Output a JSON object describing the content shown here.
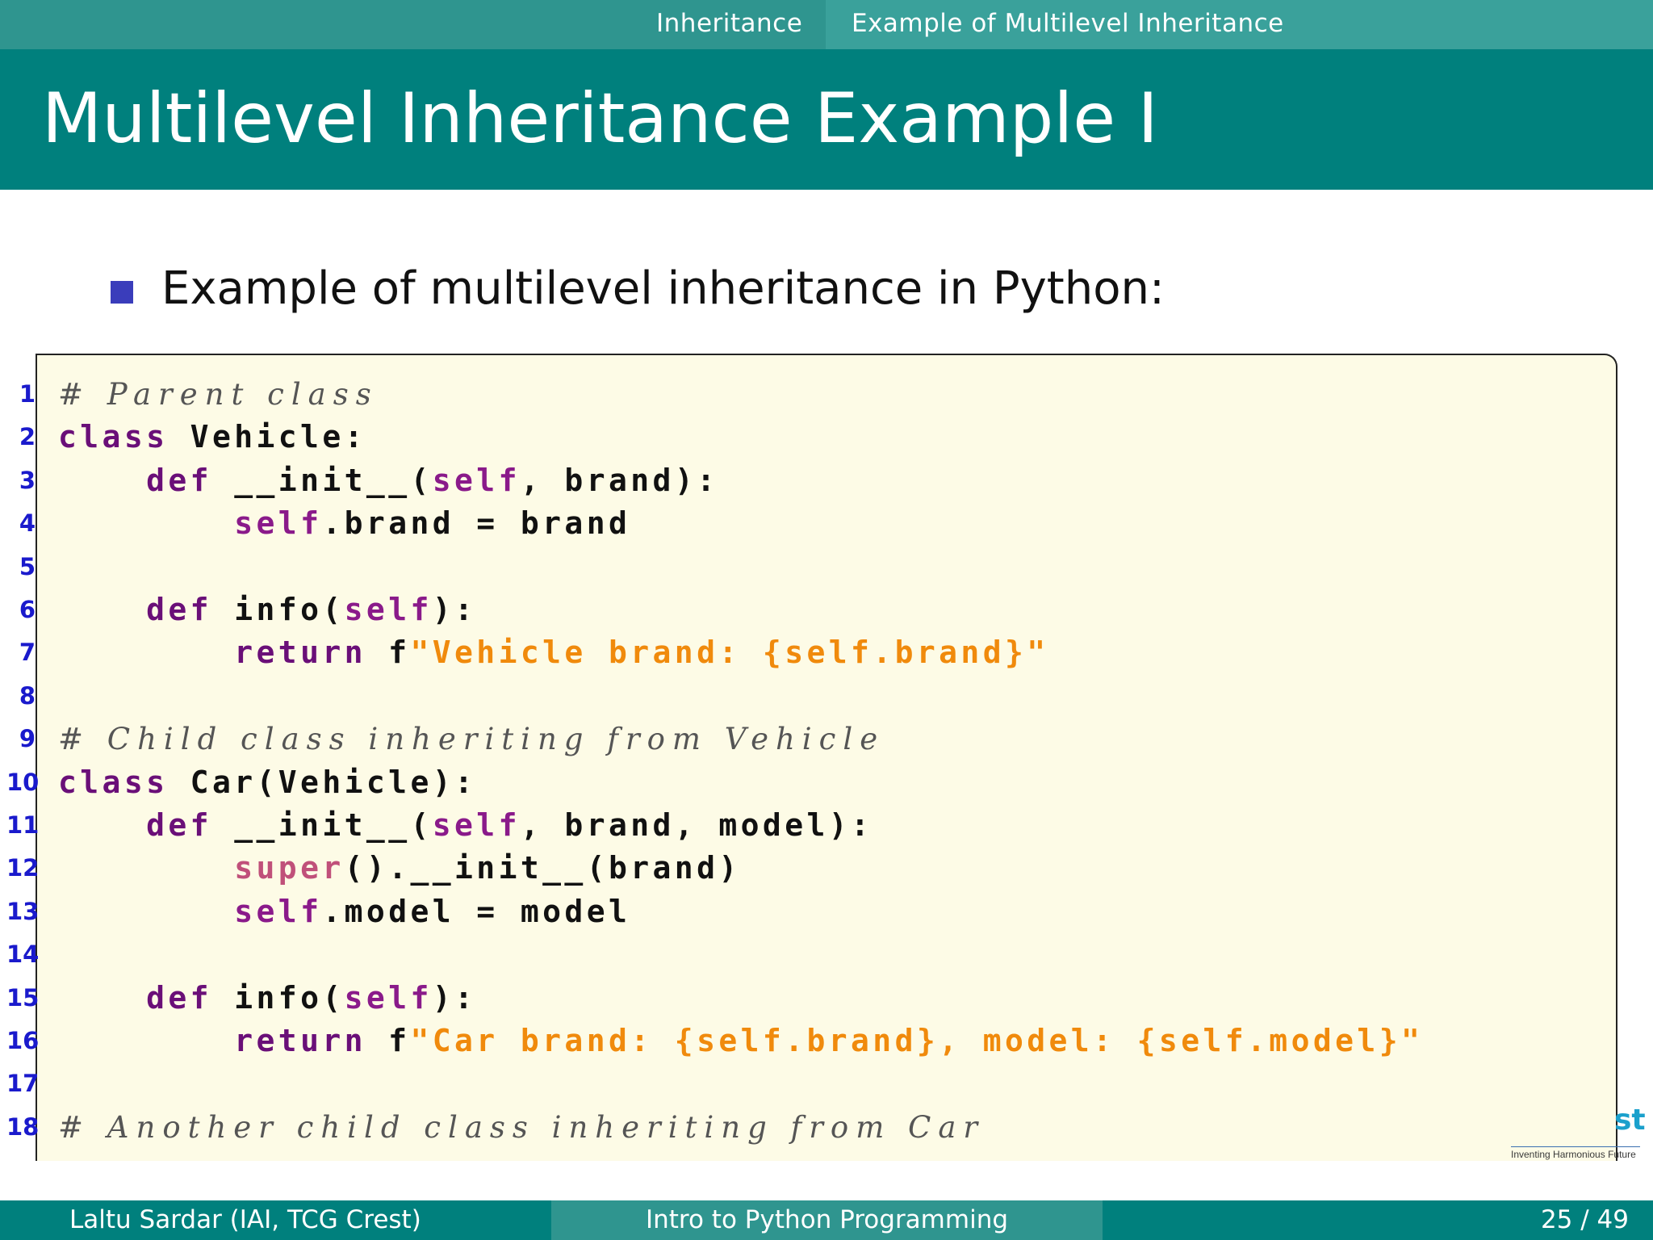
{
  "nav": {
    "section": "Inheritance",
    "subsection": "Example of Multilevel Inheritance"
  },
  "slide": {
    "title": "Multilevel Inheritance Example I",
    "bullet": "Example of multilevel inheritance in Python:"
  },
  "code": {
    "lines": [
      {
        "n": "1",
        "tokens": [
          {
            "t": "# Parent class",
            "k": "comment"
          }
        ]
      },
      {
        "n": "2",
        "tokens": [
          {
            "t": "class",
            "k": "kw"
          },
          {
            "t": " Vehicle:",
            "k": "plain"
          }
        ]
      },
      {
        "n": "3",
        "tokens": [
          {
            "t": "    ",
            "k": "plain"
          },
          {
            "t": "def",
            "k": "kw"
          },
          {
            "t": " __init__(",
            "k": "plain"
          },
          {
            "t": "self",
            "k": "self"
          },
          {
            "t": ", brand):",
            "k": "plain"
          }
        ]
      },
      {
        "n": "4",
        "tokens": [
          {
            "t": "        ",
            "k": "plain"
          },
          {
            "t": "self",
            "k": "self"
          },
          {
            "t": ".brand = brand",
            "k": "plain"
          }
        ]
      },
      {
        "n": "5",
        "tokens": []
      },
      {
        "n": "6",
        "tokens": [
          {
            "t": "    ",
            "k": "plain"
          },
          {
            "t": "def",
            "k": "kw"
          },
          {
            "t": " info(",
            "k": "plain"
          },
          {
            "t": "self",
            "k": "self"
          },
          {
            "t": "):",
            "k": "plain"
          }
        ]
      },
      {
        "n": "7",
        "tokens": [
          {
            "t": "        ",
            "k": "plain"
          },
          {
            "t": "return",
            "k": "kw"
          },
          {
            "t": " f",
            "k": "plain"
          },
          {
            "t": "\"Vehicle brand: {self.brand}\"",
            "k": "str"
          }
        ]
      },
      {
        "n": "8",
        "tokens": []
      },
      {
        "n": "9",
        "tokens": [
          {
            "t": "# Child class inheriting from Vehicle",
            "k": "comment"
          }
        ]
      },
      {
        "n": "10",
        "tokens": [
          {
            "t": "class",
            "k": "kw"
          },
          {
            "t": " Car(Vehicle):",
            "k": "plain"
          }
        ]
      },
      {
        "n": "11",
        "tokens": [
          {
            "t": "    ",
            "k": "plain"
          },
          {
            "t": "def",
            "k": "kw"
          },
          {
            "t": " __init__(",
            "k": "plain"
          },
          {
            "t": "self",
            "k": "self"
          },
          {
            "t": ", brand, model):",
            "k": "plain"
          }
        ]
      },
      {
        "n": "12",
        "tokens": [
          {
            "t": "        ",
            "k": "plain"
          },
          {
            "t": "super",
            "k": "builtin"
          },
          {
            "t": "().__init__(brand)",
            "k": "plain"
          }
        ]
      },
      {
        "n": "13",
        "tokens": [
          {
            "t": "        ",
            "k": "plain"
          },
          {
            "t": "self",
            "k": "self"
          },
          {
            "t": ".model = model",
            "k": "plain"
          }
        ]
      },
      {
        "n": "14",
        "tokens": []
      },
      {
        "n": "15",
        "tokens": [
          {
            "t": "    ",
            "k": "plain"
          },
          {
            "t": "def",
            "k": "kw"
          },
          {
            "t": " info(",
            "k": "plain"
          },
          {
            "t": "self",
            "k": "self"
          },
          {
            "t": "):",
            "k": "plain"
          }
        ]
      },
      {
        "n": "16",
        "tokens": [
          {
            "t": "        ",
            "k": "plain"
          },
          {
            "t": "return",
            "k": "kw"
          },
          {
            "t": " f",
            "k": "plain"
          },
          {
            "t": "\"Car brand: {self.brand}, model: {self.model}\"",
            "k": "str"
          }
        ]
      },
      {
        "n": "17",
        "tokens": []
      },
      {
        "n": "18",
        "tokens": [
          {
            "t": "# Another child class inheriting from Car",
            "k": "comment"
          }
        ]
      }
    ]
  },
  "logo": {
    "fragment": "st",
    "tagline": "Inventing Harmonious Future"
  },
  "footer": {
    "author": "Laltu Sardar  (IAI, TCG Crest)",
    "course": "Intro to Python Programming",
    "page": "25 / 49"
  },
  "colors": {
    "header_teal": "#00807d",
    "nav_teal": "#2f958f",
    "bullet_blue": "#3a3dbb",
    "code_bg": "#fdfbe6",
    "keyword": "#6a0f78",
    "string": "#f08a0c",
    "line_number": "#1a1acc"
  }
}
